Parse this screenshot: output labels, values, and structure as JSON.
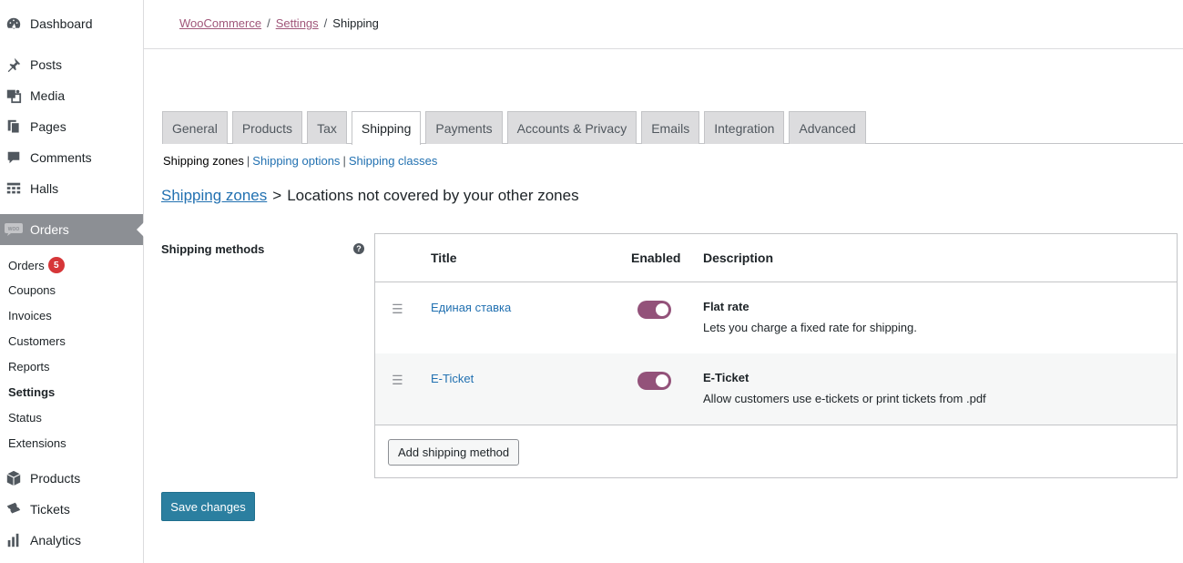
{
  "sidebar": {
    "top_items": [
      {
        "label": "Dashboard",
        "icon": "dashboard-icon"
      },
      {
        "label": "Posts",
        "icon": "pin-icon"
      },
      {
        "label": "Media",
        "icon": "media-icon"
      },
      {
        "label": "Pages",
        "icon": "pages-icon"
      },
      {
        "label": "Comments",
        "icon": "comment-icon"
      },
      {
        "label": "Halls",
        "icon": "grid-icon"
      },
      {
        "label": "Orders",
        "icon": "woo-icon"
      }
    ],
    "sub_items": [
      {
        "label": "Orders",
        "badge": "5"
      },
      {
        "label": "Coupons"
      },
      {
        "label": "Invoices"
      },
      {
        "label": "Customers"
      },
      {
        "label": "Reports"
      },
      {
        "label": "Settings"
      },
      {
        "label": "Status"
      },
      {
        "label": "Extensions"
      }
    ],
    "bottom_items": [
      {
        "label": "Products",
        "icon": "box-icon"
      },
      {
        "label": "Tickets",
        "icon": "ticket-icon"
      },
      {
        "label": "Analytics",
        "icon": "bar-chart-icon"
      }
    ]
  },
  "breadcrumb": {
    "woocommerce": "WooCommerce",
    "settings": "Settings",
    "current": "Shipping",
    "sep": "/"
  },
  "tabs": [
    "General",
    "Products",
    "Tax",
    "Shipping",
    "Payments",
    "Accounts & Privacy",
    "Emails",
    "Integration",
    "Advanced"
  ],
  "active_tab": "Shipping",
  "subnav": {
    "zones": "Shipping zones",
    "options": "Shipping options",
    "classes": "Shipping classes",
    "sep": "|"
  },
  "heading": {
    "link": "Shipping zones",
    "sep": ">",
    "text": "Locations not covered by your other zones"
  },
  "methods_label": "Shipping methods",
  "help_glyph": "?",
  "table": {
    "headers": {
      "title": "Title",
      "enabled": "Enabled",
      "description": "Description"
    },
    "rows": [
      {
        "title": "Единая ставка",
        "enabled": true,
        "name": "Flat rate",
        "description": "Lets you charge a fixed rate for shipping."
      },
      {
        "title": "E-Ticket",
        "enabled": true,
        "name": "E-Ticket",
        "description": "Allow customers use e-tickets or print tickets from .pdf"
      }
    ],
    "add_button": "Add shipping method"
  },
  "save_button": "Save changes",
  "colors": {
    "accent": "#93527a",
    "primary_button": "#2b7fa0",
    "link": "#2271b1",
    "active_menu": "#8c8f94"
  }
}
